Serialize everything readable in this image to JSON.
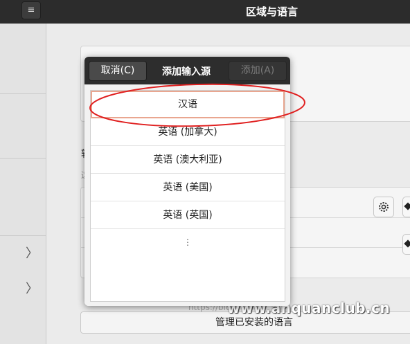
{
  "header": {
    "title": "区域与语言",
    "menu_icon": "hamburger-menu-icon",
    "menu_glyph": "≡"
  },
  "sidebar": {
    "chevron_glyph": "〉"
  },
  "background": {
    "partial_label_1": "转",
    "partial_label_2": "这",
    "manage_button": "管理已安装的语言"
  },
  "dialog": {
    "cancel_label": "取消(C)",
    "title": "添加输入源",
    "add_label": "添加(A)",
    "languages": [
      "汉语",
      "英语 (加拿大)",
      "英语 (澳大利亚)",
      "英语 (美国)",
      "英语 (英国)"
    ],
    "selected_index": 0,
    "more_glyph": "⋮"
  },
  "annotation": {
    "color": "#e02020"
  },
  "watermark": {
    "text": "www.anquanclub.cn",
    "faint_text": "https://blog."
  },
  "colors": {
    "header": "#2c2c2c",
    "selection_outline": "#e9a690"
  }
}
